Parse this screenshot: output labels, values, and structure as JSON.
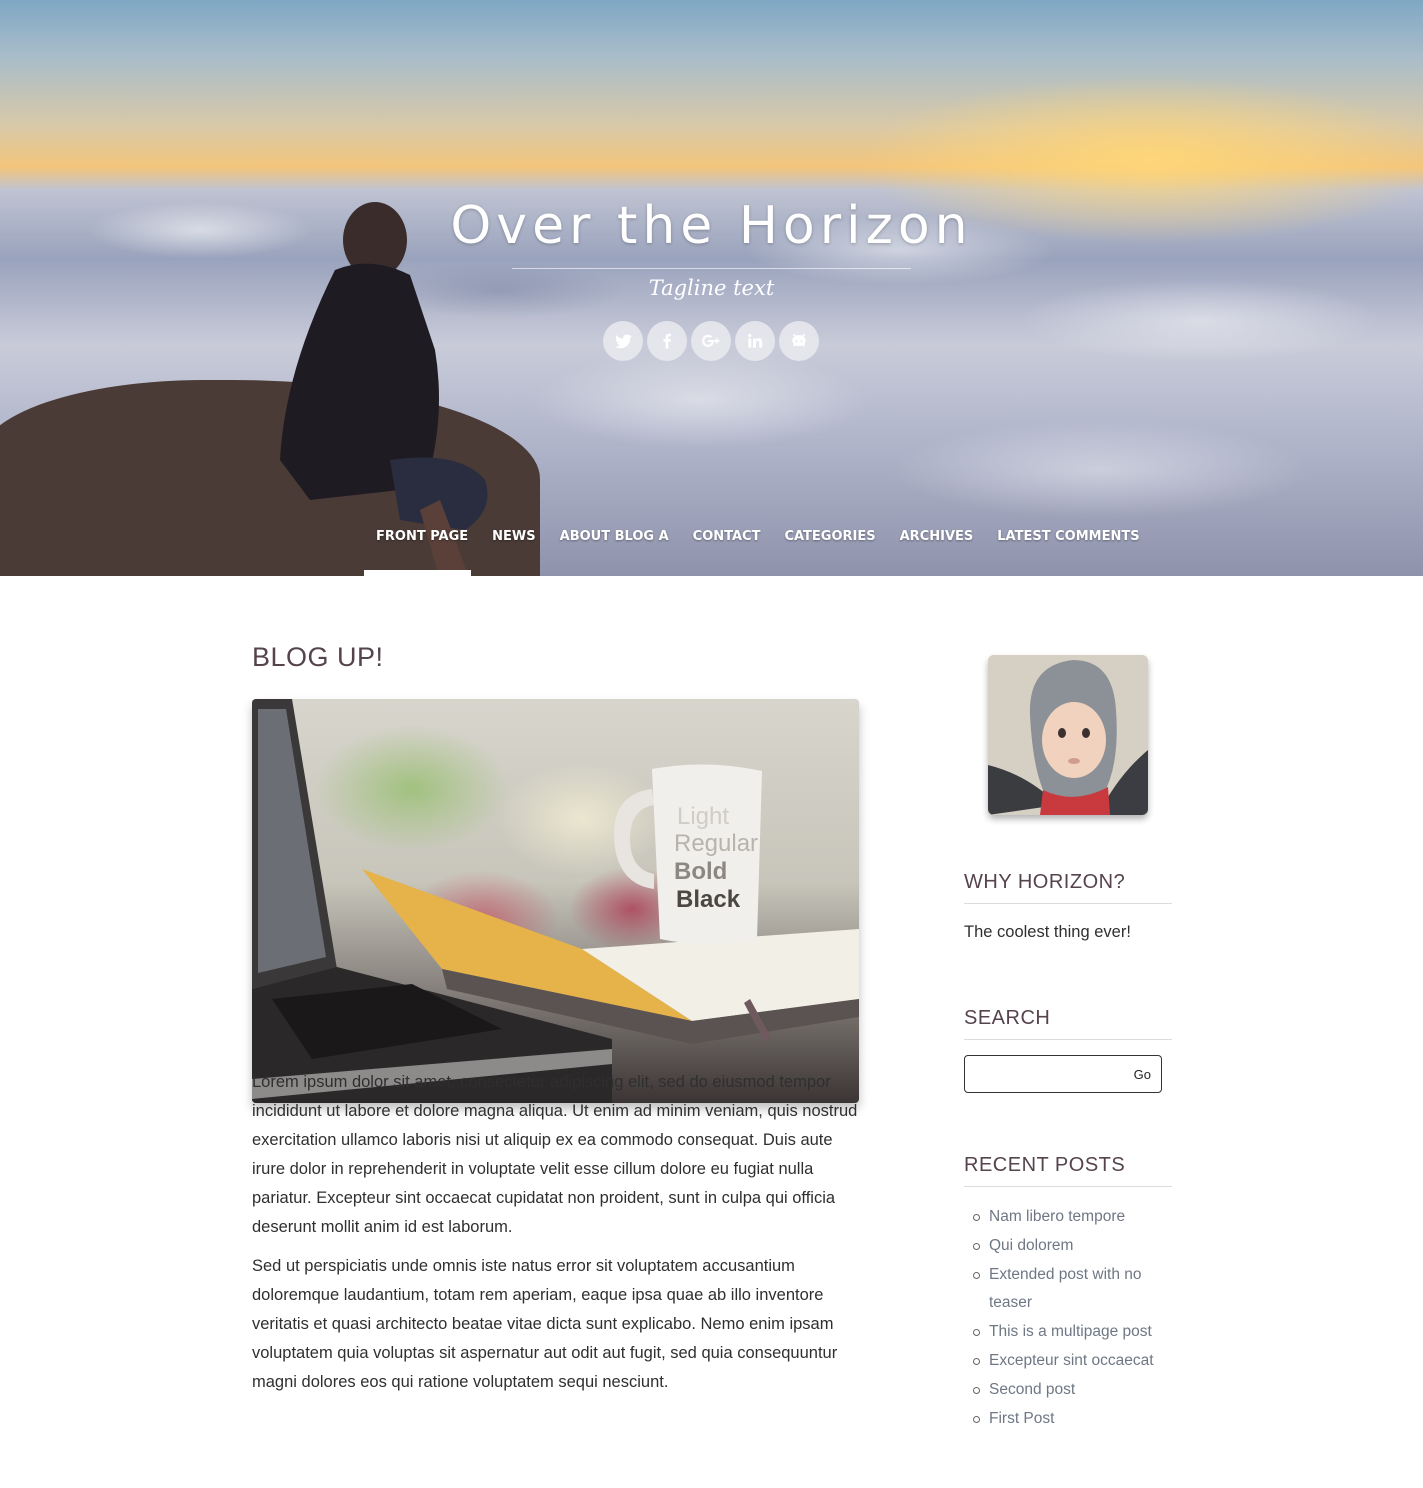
{
  "site": {
    "title": "Over the Horizon",
    "tagline": "Tagline text"
  },
  "social": [
    {
      "icon": "twitter-icon"
    },
    {
      "icon": "facebook-icon"
    },
    {
      "icon": "google-plus-icon"
    },
    {
      "icon": "linkedin-icon"
    },
    {
      "icon": "github-icon"
    }
  ],
  "nav": {
    "items": [
      {
        "label": "FRONT PAGE",
        "active": true
      },
      {
        "label": "NEWS"
      },
      {
        "label": "ABOUT BLOG A"
      },
      {
        "label": "CONTACT"
      },
      {
        "label": "CATEGORIES"
      },
      {
        "label": "ARCHIVES"
      },
      {
        "label": "LATEST COMMENTS"
      }
    ]
  },
  "post": {
    "title": "BLOG UP!",
    "paragraphs": [
      "Lorem ipsum dolor sit amet, consectetur adipiscing elit, sed do eiusmod tempor incididunt ut labore et dolore magna aliqua. Ut enim ad minim veniam, quis nostrud exercitation ullamco laboris nisi ut aliquip ex ea commodo consequat. Duis aute irure dolor in reprehenderit in voluptate velit esse cillum dolore eu fugiat nulla pariatur. Excepteur sint occaecat cupidatat non proident, sunt in culpa qui officia deserunt mollit anim id est laborum.",
      "Sed ut perspiciatis unde omnis iste natus error sit voluptatem accusantium doloremque laudantium, totam rem aperiam, eaque ipsa quae ab illo inventore veritatis et quasi architecto beatae vitae dicta sunt explicabo. Nemo enim ipsam voluptatem quia voluptas sit aspernatur aut odit aut fugit, sed quia consequuntur magni dolores eos qui ratione voluptatem sequi nesciunt."
    ],
    "image_mug_text": [
      "Light",
      "Regular",
      "Bold",
      "Black"
    ]
  },
  "sidebar": {
    "why": {
      "title": "WHY HORIZON?",
      "text": "The coolest thing ever!"
    },
    "search": {
      "title": "SEARCH",
      "value": "",
      "placeholder": "",
      "button": "Go"
    },
    "recent": {
      "title": "RECENT POSTS",
      "items": [
        "Nam libero tempore",
        "Qui dolorem",
        "Extended post with no teaser",
        "This is a multipage post",
        "Excepteur sint occaecat",
        "Second post",
        "First Post"
      ]
    }
  },
  "colors": {
    "heading": "#55434d",
    "link": "#6f7785",
    "body_text": "#2f2f2f"
  }
}
